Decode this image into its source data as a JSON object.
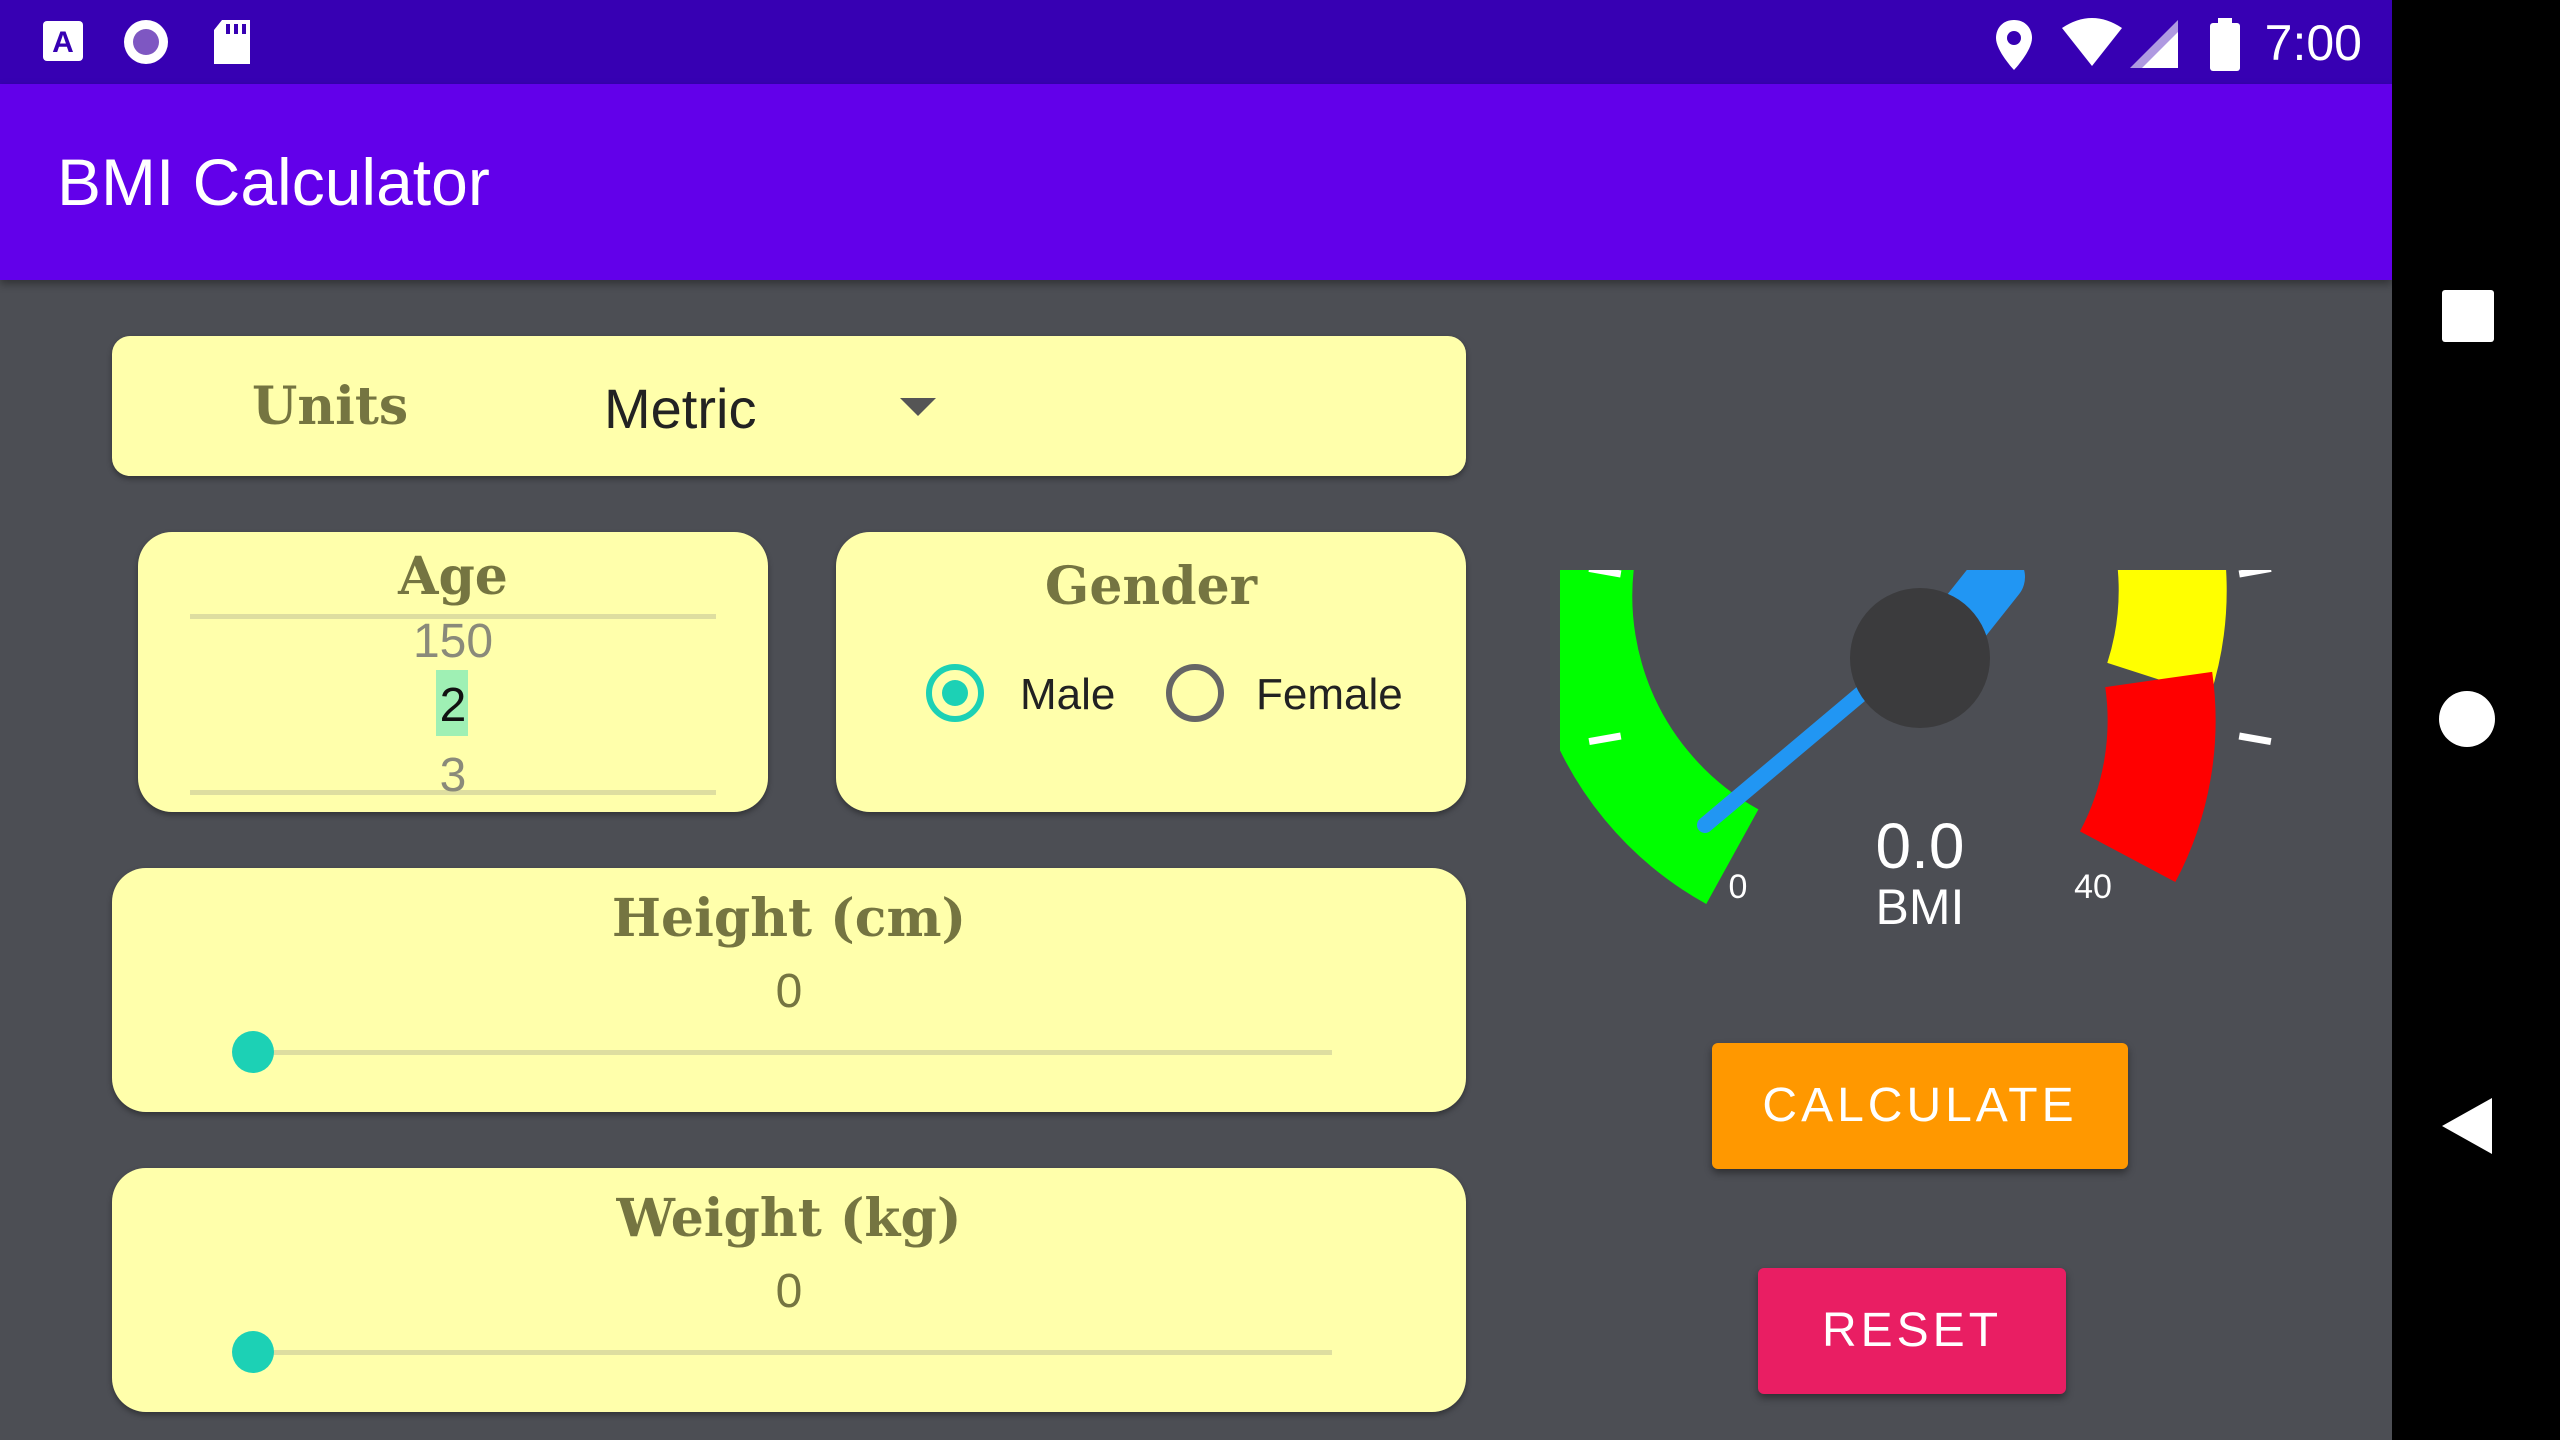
{
  "status_bar": {
    "time": "7:00",
    "icons": [
      "font-app-icon",
      "radio-circle-icon",
      "sd-card-icon",
      "location-icon",
      "wifi-icon",
      "signal-icon",
      "battery-icon"
    ]
  },
  "app_bar": {
    "title": "BMI Calculator"
  },
  "units": {
    "label": "Units",
    "selected": "Metric"
  },
  "age": {
    "title": "Age",
    "prev": "150",
    "current": "2",
    "next": "3"
  },
  "gender": {
    "title": "Gender",
    "options": [
      "Male",
      "Female"
    ],
    "selected": "Male"
  },
  "height": {
    "title": "Height (cm)",
    "value": "0",
    "slider_fraction": 0
  },
  "weight": {
    "title": "Weight (kg)",
    "value": "0",
    "slider_fraction": 0
  },
  "gauge": {
    "value": "0.0",
    "unit": "BMI",
    "min_label": "0",
    "max_label": "40",
    "zones": [
      {
        "color": "#00ff00",
        "name": "green"
      },
      {
        "color": "#ffff00",
        "name": "yellow"
      },
      {
        "color": "#ff0000",
        "name": "red"
      }
    ]
  },
  "buttons": {
    "calculate": "CALCULATE",
    "reset": "RESET"
  },
  "colors": {
    "status_bar": "#3700b3",
    "app_bar": "#6200ea",
    "background": "#4c4e54",
    "card": "#ffffab",
    "accent": "#1cd1b5",
    "calculate": "#ff9800",
    "reset": "#e91e63",
    "needle": "#2196f3"
  },
  "nav_bar": {
    "icons": [
      "overview-square-icon",
      "home-circle-icon",
      "back-triangle-icon"
    ]
  }
}
